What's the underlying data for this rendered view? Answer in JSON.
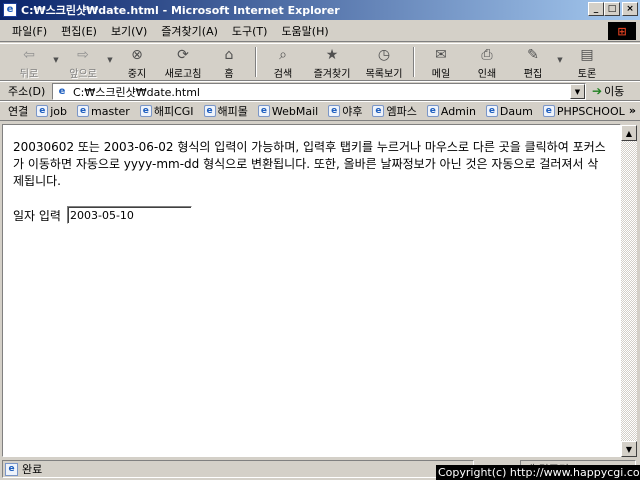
{
  "window": {
    "title": "C:₩스크린샷₩date.html - Microsoft Internet Explorer",
    "minimize": "_",
    "maximize": "□",
    "close": "×"
  },
  "menu": [
    "파일(F)",
    "편집(E)",
    "보기(V)",
    "즐겨찾기(A)",
    "도구(T)",
    "도움말(H)"
  ],
  "toolbar": {
    "back": "뒤로",
    "forward": "앞으로",
    "stop": "중지",
    "refresh": "새로고침",
    "home": "홈",
    "search": "검색",
    "favorites": "즐겨찾기",
    "history": "목록보기",
    "mail": "메일",
    "print": "인쇄",
    "edit": "편집",
    "discuss": "토론"
  },
  "address": {
    "label": "주소(D)",
    "value": "C:₩스크린샷₩date.html",
    "go": "이동"
  },
  "links": {
    "label": "연결",
    "items": [
      "job",
      "master",
      "해피CGI",
      "해피몰",
      "WebMail",
      "야후",
      "엠파스",
      "Admin",
      "Daum",
      "PHPSCHOOL"
    ],
    "more": "»"
  },
  "page": {
    "description": "20030602 또는 2003-06-02 형식의 입력이 가능하며, 입력후 탭키를 누르거나 마우스로 다른 곳을 클릭하여 포커스가 이동하면 자동으로 yyyy-mm-dd 형식으로 변환됩니다. 또한, 올바른 날짜정보가 아닌 것은 자동으로 걸러져서 삭제됩니다.",
    "date_label": "일자 입력",
    "date_value": "2003-05-10"
  },
  "status": {
    "text": "완료",
    "zone": "내 컴퓨터"
  },
  "overlay": {
    "copyright": "Copyright(c) http://www.happycgi.com"
  }
}
